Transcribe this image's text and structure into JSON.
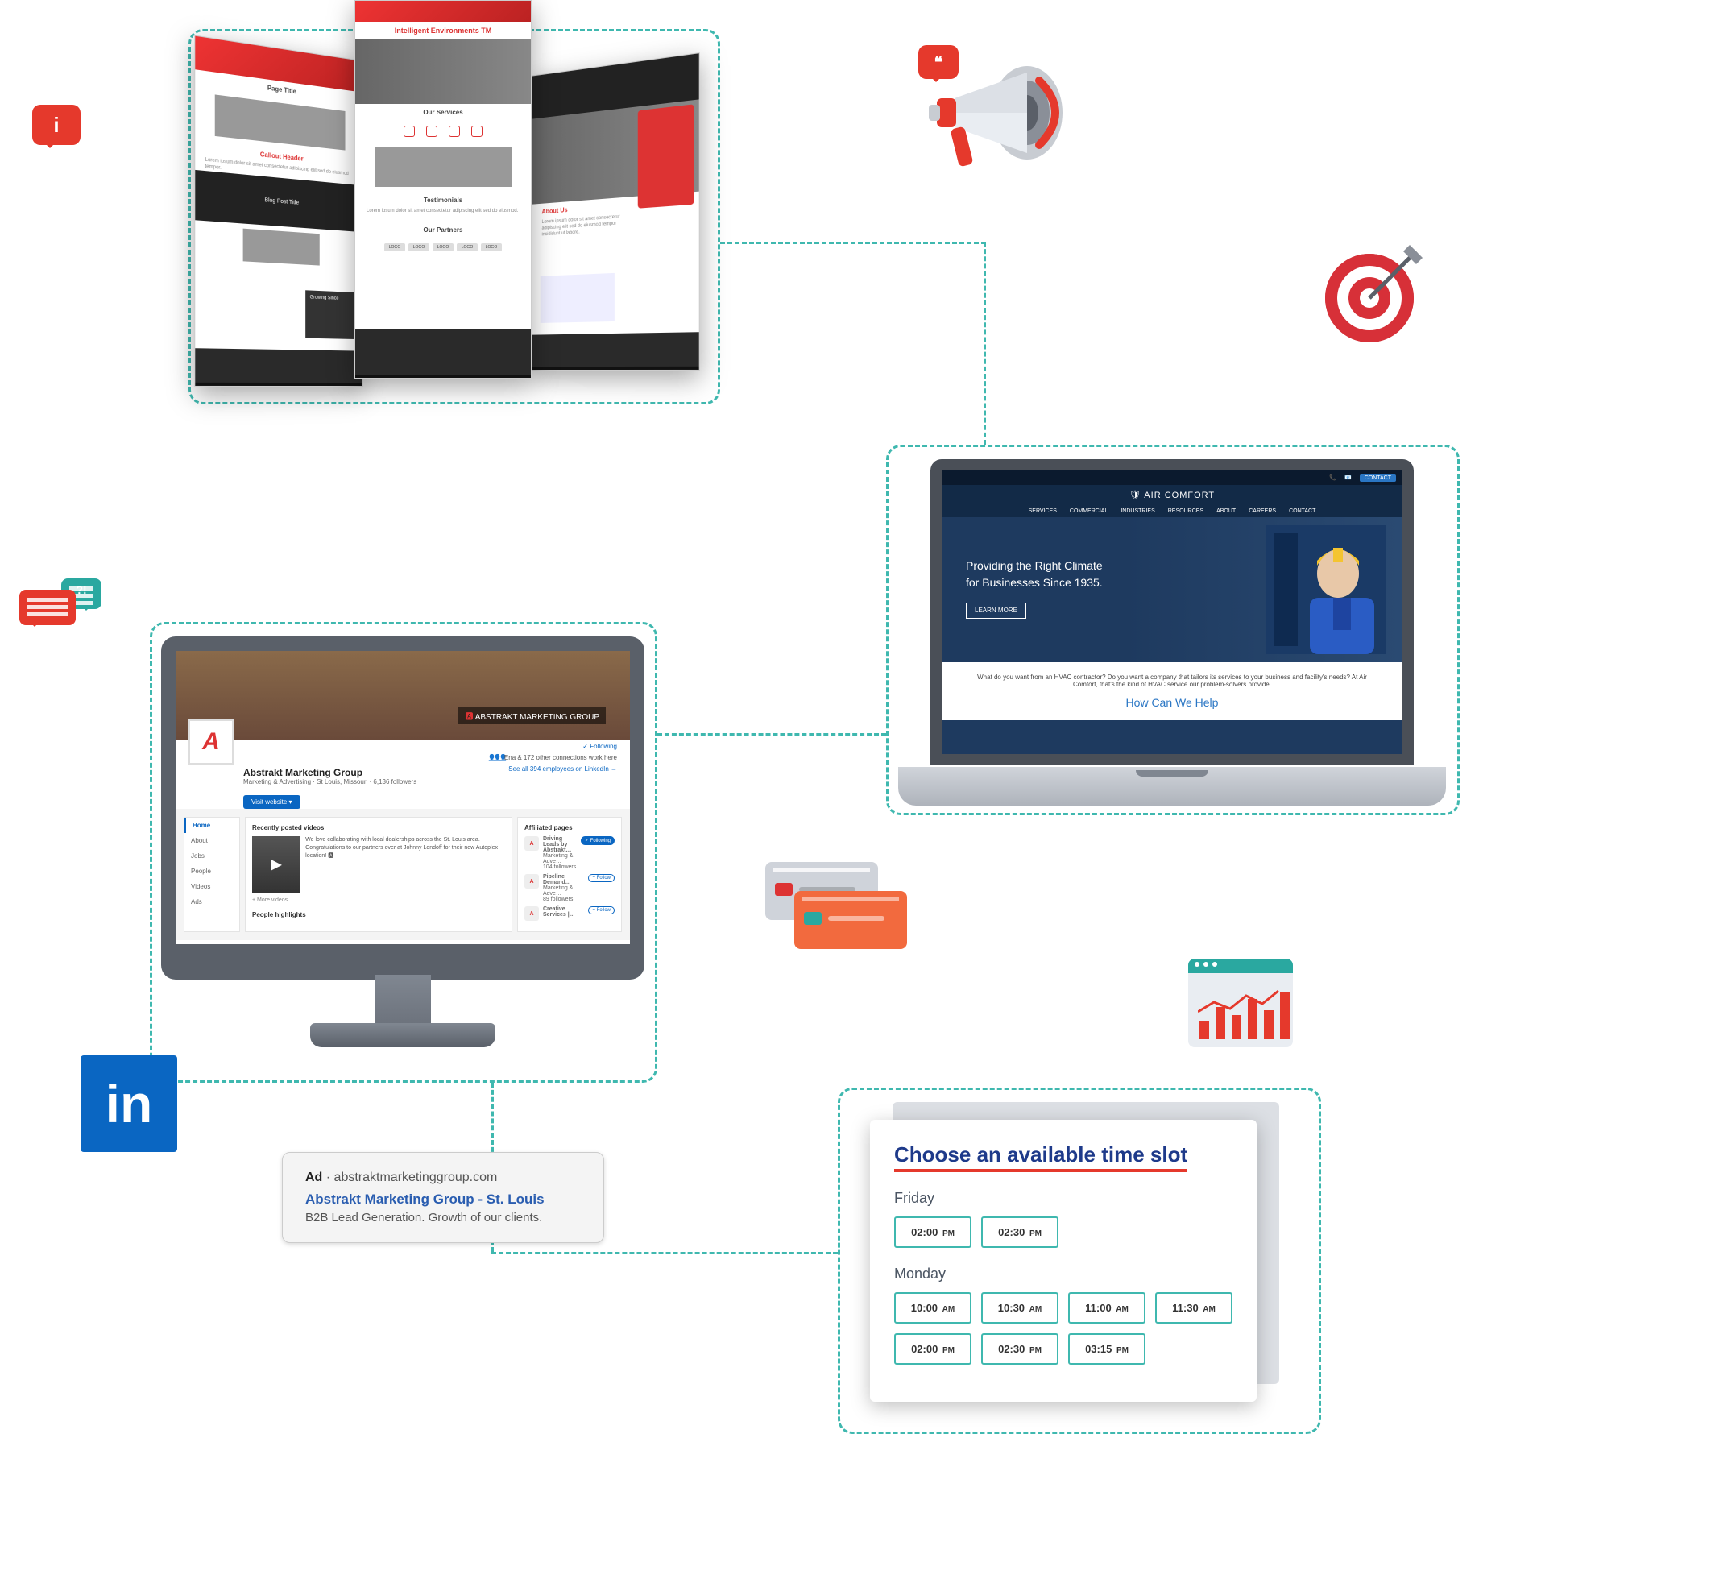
{
  "mockups": {
    "center": {
      "headline": "Intelligent Environments TM",
      "services_title": "Our Services",
      "testimonials_title": "Testimonials",
      "partners_title": "Our Partners",
      "partner_chip": "LOGO"
    },
    "left": {
      "page_title": "Page Title",
      "callout_title": "Callout Header",
      "blog_title": "Blog Post Title",
      "sidebar_heading": "Growing Since"
    },
    "right": {
      "about_title": "About Us"
    }
  },
  "laptop": {
    "brand": "🛡 AIR COMFORT",
    "nav": [
      "SERVICES",
      "COMMERCIAL",
      "INDUSTRIES",
      "RESOURCES",
      "ABOUT",
      "CAREERS",
      "CONTACT"
    ],
    "hero_line_1": "Providing the Right Climate",
    "hero_line_2": "for Businesses Since 1935.",
    "hero_btn": "LEARN MORE",
    "body_text": "What do you want from an HVAC contractor? Do you want a company that tailors its services to your business and facility's needs? At Air Comfort, that's the kind of HVAC service our problem-solvers provide.",
    "help_title": "How Can We Help"
  },
  "desktop": {
    "banner_sign": "ABSTRAKT MARKETING GROUP",
    "company": "Abstrakt Marketing Group",
    "sub": "Marketing & Advertising · St Louis, Missouri · 6,136 followers",
    "following": "✓ Following",
    "connections": "Ena & 172 other connections work here",
    "see_all": "See all 394 employees on LinkedIn →",
    "visit_btn": "Visit website ▾",
    "side_nav": [
      "Home",
      "About",
      "Jobs",
      "People",
      "Videos",
      "Ads"
    ],
    "mid_title": "Recently posted videos",
    "vid_blurb": "We love collaborating with local dealerships across the St. Louis area. Congratulations to our partners over at Johnny Londoff for their new Autoplex location! 🅰",
    "more_videos": "+ More videos",
    "ph_title": "People highlights",
    "aff_title": "Affiliated pages",
    "aff": [
      {
        "name": "Driving Leads by Abstrakt…",
        "sub": "Marketing & Adve…",
        "f": "104 followers",
        "btn": "✓ Following",
        "on": true
      },
      {
        "name": "Pipeline Demand…",
        "sub": "Marketing & Adve…",
        "f": "89 followers",
        "btn": "+ Follow",
        "on": false
      },
      {
        "name": "Creative Services |…",
        "sub": "",
        "f": "",
        "btn": "+ Follow",
        "on": false
      }
    ]
  },
  "ad": {
    "prefix": "Ad",
    "domain": "abstraktmarketinggroup.com",
    "title": "Abstrakt Marketing Group - St. Louis",
    "desc": "B2B Lead Generation. Growth of our clients."
  },
  "scheduler": {
    "title": "Choose an available time slot",
    "days": [
      {
        "label": "Friday",
        "slots": [
          {
            "t": "02:00",
            "p": "PM"
          },
          {
            "t": "02:30",
            "p": "PM"
          }
        ]
      },
      {
        "label": "Monday",
        "slots": [
          {
            "t": "10:00",
            "p": "AM"
          },
          {
            "t": "10:30",
            "p": "AM"
          },
          {
            "t": "11:00",
            "p": "AM"
          },
          {
            "t": "11:30",
            "p": "AM"
          },
          {
            "t": "02:00",
            "p": "PM"
          },
          {
            "t": "02:30",
            "p": "PM"
          },
          {
            "t": "03:15",
            "p": "PM"
          }
        ]
      }
    ]
  },
  "icons": {
    "info": "i",
    "qm": "?!",
    "quote": "❝",
    "linkedin": "in"
  }
}
